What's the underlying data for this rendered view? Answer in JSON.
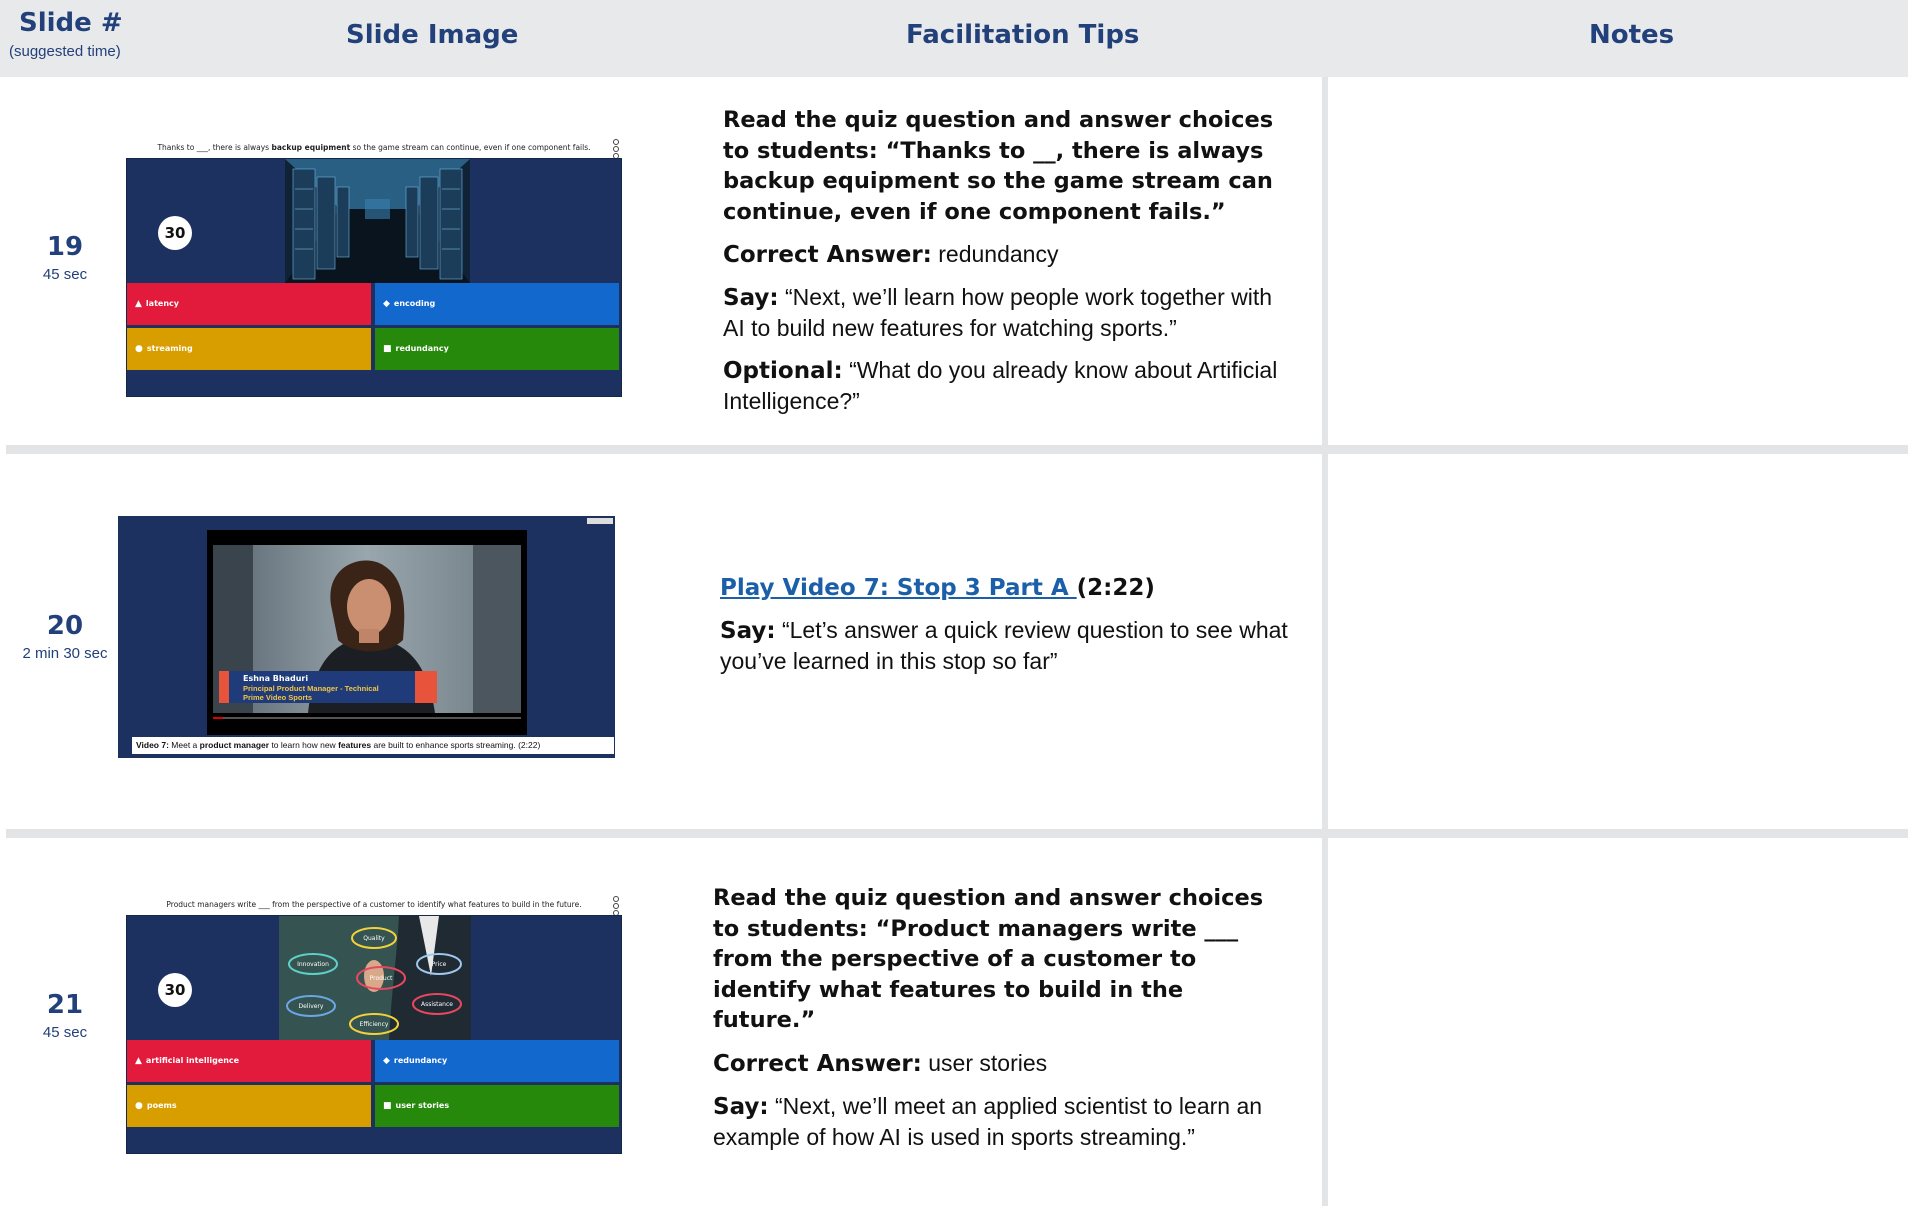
{
  "header": {
    "slide_col": "Slide #",
    "slide_col_sub": "(suggested time)",
    "image_col": "Slide Image",
    "tips_col": "Facilitation Tips",
    "notes_col": "Notes"
  },
  "rows": [
    {
      "slide_number": "19",
      "time": "45 sec",
      "quiz": {
        "question_pre": "Thanks to ___, there is always ",
        "question_bold": "backup equipment",
        "question_post": " so the game stream can continue, even if one component fails.",
        "timer": "30",
        "answers": [
          "latency",
          "encoding",
          "streaming",
          "redundancy"
        ]
      },
      "tips": {
        "intro": "Read the quiz question and answer choices to students: “Thanks to __, there is always backup equipment so the game stream can continue, even if one component fails.”",
        "correct_label": "Correct Answer:",
        "correct_value": "redundancy",
        "say_label": "Say:",
        "say_text": "“Next, we’ll learn how people work together with AI to build new features for watching sports.”",
        "optional_label": "Optional:",
        "optional_text": "“What do you already know about Artificial Intelligence?”"
      }
    },
    {
      "slide_number": "20",
      "time": "2 min 30 sec",
      "video": {
        "name": "Eshna Bhaduri",
        "role_line1": "Principal Product Manager - Technical",
        "role_line2": "Prime Video Sports",
        "caption_label": "Video 7:",
        "caption_1": " Meet a ",
        "caption_bold_1": "product manager",
        "caption_2": " to learn how new ",
        "caption_bold_2": "features",
        "caption_3": " are built to enhance sports streaming. (2:22)"
      },
      "tips": {
        "link_text": "Play Video 7: Stop 3 Part A ",
        "duration": "(2:22)",
        "say_label": "Say:",
        "say_text": "“Let’s answer a quick review question to see what you’ve learned in this stop so far”"
      }
    },
    {
      "slide_number": "21",
      "time": "45 sec",
      "quiz": {
        "question_pre": "Product managers write ___ from the perspective of a customer to identify what features to build in the future.",
        "question_bold": "",
        "question_post": "",
        "timer": "30",
        "answers": [
          "artificial intelligence",
          "redundancy",
          "poems",
          "user stories"
        ]
      },
      "diagram_labels": [
        "Quality",
        "Innovation",
        "Price",
        "Product",
        "Delivery",
        "Assistance",
        "Efficiency"
      ],
      "tips": {
        "intro": "Read the quiz question and answer choices to students: “Product managers write ___ from the perspective of a customer to identify what features to build in the future.”",
        "correct_label": "Correct Answer:",
        "correct_value": "user stories",
        "say_label": "Say:",
        "say_text": "“Next, we’ll meet an applied scientist to learn an example of how AI is used in sports streaming.”"
      }
    }
  ],
  "colors": {
    "header_bg": "#e8e9eb",
    "heading_blue": "#22407a",
    "board_navy": "#1d3160",
    "answer_red": "#e21b3c",
    "answer_blue": "#1368ce",
    "answer_gold": "#d89e00",
    "answer_green": "#26890c",
    "link_blue": "#1b5fa8"
  },
  "icons": {
    "answer_1": "triangle-icon",
    "answer_2": "diamond-icon",
    "answer_3": "circle-icon",
    "answer_4": "square-icon"
  }
}
